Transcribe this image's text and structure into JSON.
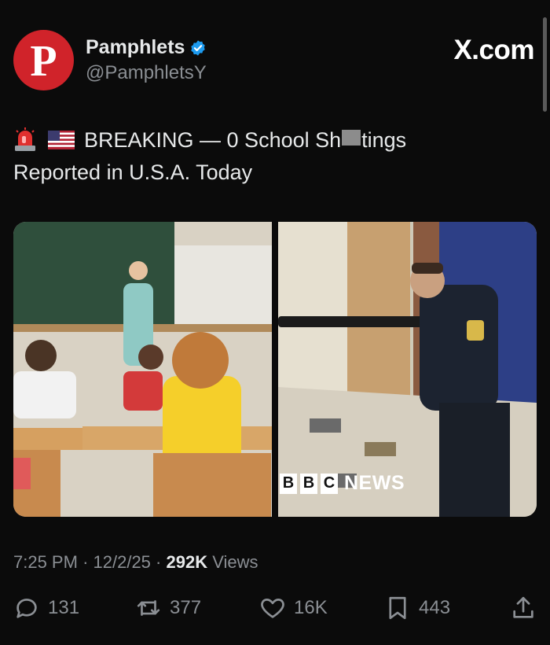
{
  "account": {
    "avatar_letter": "P",
    "display_name": "Pamphlets",
    "handle": "@PamphletsY",
    "verified": true
  },
  "watermark": "X.com",
  "post": {
    "emojis": [
      "police-light-icon",
      "us-flag-icon"
    ],
    "text_part1": "BREAKING — 0 School Sh",
    "text_part2": "tings",
    "text_line2": "Reported in U.S.A. Today"
  },
  "media": {
    "right_image_overlay_letters": [
      "B",
      "B",
      "C"
    ],
    "right_image_overlay_text": "NEWS"
  },
  "meta": {
    "time": "7:25 PM",
    "date": "12/2/25",
    "views_count": "292K",
    "views_label": "Views",
    "separator": "·"
  },
  "actions": {
    "replies": "131",
    "reposts": "377",
    "likes": "16K",
    "bookmarks": "443"
  },
  "colors": {
    "background": "#0b0b0b",
    "avatar": "#d0232a",
    "verified": "#1d9bf0",
    "muted": "#8b8f94"
  }
}
